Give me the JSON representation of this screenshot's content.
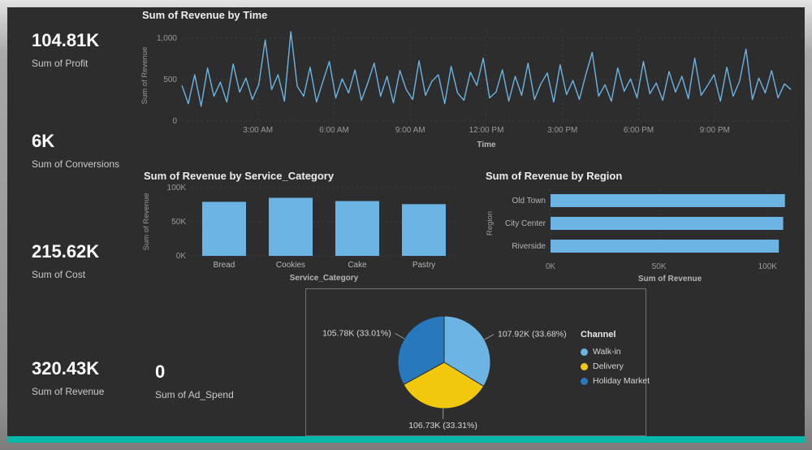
{
  "frame": {
    "accent_color": "#01B8AA",
    "background": "#2d2d2d"
  },
  "kpis": [
    {
      "value": "104.81K",
      "label": "Sum of Profit"
    },
    {
      "value": "6K",
      "label": "Sum of Conversions"
    },
    {
      "value": "215.62K",
      "label": "Sum of Cost"
    },
    {
      "value": "320.43K",
      "label": "Sum of Revenue"
    },
    {
      "value": "0",
      "label": "Sum of Ad_Spend"
    }
  ],
  "chart_data": [
    {
      "type": "line",
      "title": "Sum of Revenue by Time",
      "xlabel": "Time",
      "ylabel": "Sum of Revenue",
      "color": "#6CB4E4",
      "ylim": [
        0,
        1100
      ],
      "y_ticks": [
        {
          "label": "0",
          "value": 0
        },
        {
          "label": "500",
          "value": 500
        },
        {
          "label": "1,000",
          "value": 1000
        }
      ],
      "x_ticks": [
        {
          "label": "3:00 AM",
          "f": 0.125
        },
        {
          "label": "6:00 AM",
          "f": 0.25
        },
        {
          "label": "9:00 AM",
          "f": 0.375
        },
        {
          "label": "12:00 PM",
          "f": 0.5
        },
        {
          "label": "3:00 PM",
          "f": 0.625
        },
        {
          "label": "6:00 PM",
          "f": 0.75
        },
        {
          "label": "9:00 PM",
          "f": 0.875
        }
      ],
      "values": [
        430,
        210,
        560,
        180,
        640,
        300,
        470,
        230,
        690,
        350,
        520,
        260,
        440,
        980,
        380,
        560,
        240,
        1080,
        420,
        300,
        650,
        230,
        480,
        720,
        280,
        510,
        340,
        620,
        250,
        460,
        700,
        300,
        540,
        220,
        610,
        380,
        260,
        730,
        310,
        480,
        560,
        210,
        660,
        340,
        250,
        590,
        430,
        760,
        280,
        350,
        620,
        240,
        540,
        310,
        700,
        260,
        450,
        580,
        230,
        680,
        320,
        490,
        260,
        560,
        830,
        300,
        440,
        240,
        640,
        360,
        510,
        280,
        720,
        330,
        460,
        250,
        600,
        350,
        540,
        270,
        760,
        310,
        430,
        560,
        240,
        650,
        300,
        480,
        870,
        260,
        520,
        340,
        610,
        280,
        450,
        380
      ]
    },
    {
      "type": "bar",
      "title": "Sum of Revenue by Service_Category",
      "xlabel": "Service_Category",
      "ylabel": "Sum of Revenue",
      "color": "#6CB4E4",
      "ylim": [
        0,
        100000
      ],
      "y_ticks": [
        {
          "label": "0K",
          "value": 0
        },
        {
          "label": "50K",
          "value": 50000
        },
        {
          "label": "100K",
          "value": 100000
        }
      ],
      "categories": [
        "Bread",
        "Cookies",
        "Cake",
        "Pastry"
      ],
      "values": [
        79200,
        85100,
        80300,
        75800
      ]
    },
    {
      "type": "hbar",
      "title": "Sum of Revenue by Region",
      "xlabel": "Sum of Revenue",
      "ylabel": "Region",
      "color": "#6CB4E4",
      "xlim": [
        0,
        110000
      ],
      "x_ticks": [
        {
          "label": "0K",
          "value": 0
        },
        {
          "label": "50K",
          "value": 50000
        },
        {
          "label": "100K",
          "value": 100000
        }
      ],
      "categories": [
        "Old Town",
        "City Center",
        "Riverside"
      ],
      "values": [
        108000,
        107200,
        105200
      ]
    },
    {
      "type": "pie",
      "legend_title": "Channel",
      "slices": [
        {
          "name": "Walk-in",
          "label": "107.92K (33.68%)",
          "pct": 33.68,
          "color": "#6CB4E4"
        },
        {
          "name": "Delivery",
          "label": "106.73K (33.31%)",
          "pct": 33.31,
          "color": "#F2C80F"
        },
        {
          "name": "Holiday Market",
          "label": "105.78K (33.01%)",
          "pct": 33.01,
          "color": "#2878BE"
        }
      ]
    }
  ]
}
